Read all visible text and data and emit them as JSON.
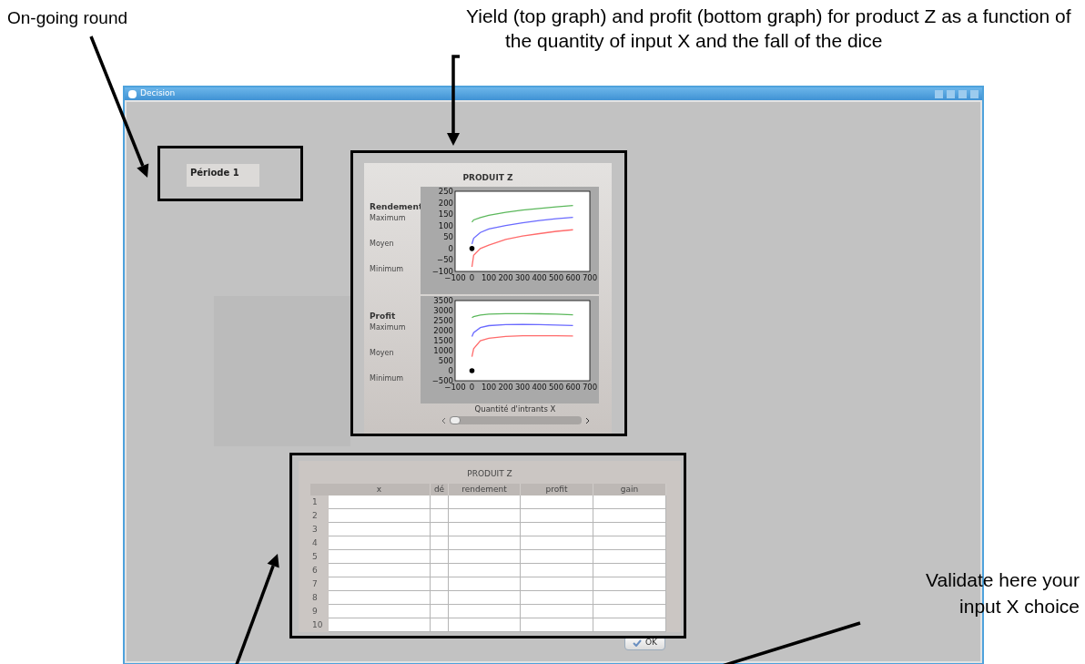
{
  "annotations": [
    {
      "text": "On-going round"
    },
    {
      "text": "Yield (top graph) and profit (bottom graph) for product Z as a function of the quantity of input X and the fall of the dice"
    },
    {
      "text": "Validate here your input X choice"
    }
  ],
  "window": {
    "title": "Decision"
  },
  "period": {
    "label": "Période 1"
  },
  "graphs": {
    "title": "PRODUIT Z",
    "panels": [
      {
        "heading": "Rendement",
        "chart_data": {
          "type": "line",
          "x": [
            0,
            10,
            50,
            100,
            200,
            300,
            400,
            500,
            600
          ],
          "xlim": [
            -100,
            700
          ],
          "ylim": [
            -100,
            250
          ],
          "xticks": [
            -100,
            0,
            100,
            200,
            300,
            400,
            500,
            600,
            700
          ],
          "yticks": [
            -100,
            -50,
            0,
            50,
            100,
            150,
            200,
            250
          ],
          "series": [
            {
              "name": "Maximum",
              "color": "#5cb85c",
              "values": [
                115,
                125,
                135,
                145,
                158,
                168,
                175,
                182,
                188
              ]
            },
            {
              "name": "Moyen",
              "color": "#6a6aff",
              "values": [
                20,
                45,
                70,
                85,
                100,
                112,
                122,
                130,
                136
              ]
            },
            {
              "name": "Minimum",
              "color": "#ff6b6b",
              "values": [
                -80,
                -30,
                0,
                15,
                40,
                55,
                65,
                75,
                82
              ]
            }
          ]
        }
      },
      {
        "heading": "Profit",
        "chart_data": {
          "type": "line",
          "x": [
            0,
            10,
            50,
            100,
            200,
            300,
            400,
            500,
            600
          ],
          "xlim": [
            -100,
            700
          ],
          "ylim": [
            -500,
            3500
          ],
          "xticks": [
            -100,
            0,
            100,
            200,
            300,
            400,
            500,
            600,
            700
          ],
          "yticks": [
            -500,
            0,
            500,
            1000,
            1500,
            2000,
            2500,
            3000,
            3500
          ],
          "series": [
            {
              "name": "Maximum",
              "color": "#5cb85c",
              "values": [
                2650,
                2700,
                2780,
                2820,
                2850,
                2850,
                2840,
                2820,
                2790
              ]
            },
            {
              "name": "Moyen",
              "color": "#6a6aff",
              "values": [
                1700,
                1900,
                2150,
                2250,
                2300,
                2310,
                2300,
                2280,
                2260
              ]
            },
            {
              "name": "Minimum",
              "color": "#ff6b6b",
              "values": [
                700,
                1100,
                1500,
                1620,
                1710,
                1740,
                1740,
                1740,
                1730
              ]
            }
          ]
        }
      }
    ],
    "xlabel": "Quantité d'intrants X"
  },
  "table": {
    "title": "PRODUIT Z",
    "columns": [
      "x",
      "dé",
      "rendement",
      "profit",
      "gain"
    ],
    "rows": [
      {
        "label": "1"
      },
      {
        "label": "2"
      },
      {
        "label": "3"
      },
      {
        "label": "4"
      },
      {
        "label": "5"
      },
      {
        "label": "6"
      },
      {
        "label": "7"
      },
      {
        "label": "8"
      },
      {
        "label": "9"
      },
      {
        "label": "10"
      }
    ]
  },
  "buttons": [
    {
      "label": "OK"
    }
  ]
}
